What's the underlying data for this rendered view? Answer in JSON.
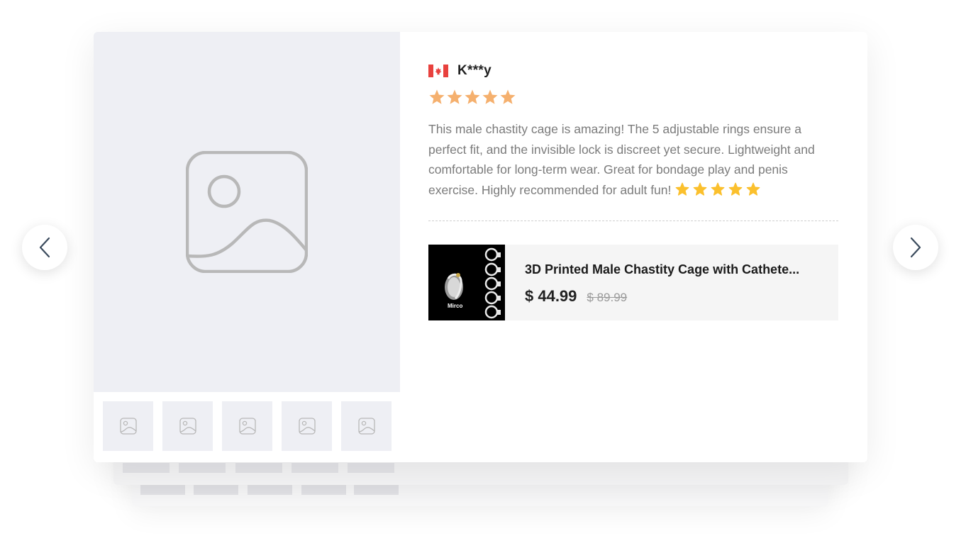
{
  "review": {
    "reviewer_name": "K***y",
    "country": "Canada",
    "rating": 5,
    "text": "This male chastity cage is amazing! The 5 adjustable rings ensure a perfect fit, and the invisible lock is discreet yet secure. Lightweight and comfortable for long-term wear. Great for bondage play and penis exercise. Highly recommended for adult fun!",
    "emoji_star_count": 5
  },
  "product": {
    "title": "3D Printed Male Chastity Cage with Cathete...",
    "price": "$ 44.99",
    "original_price": "$ 89.99",
    "image_label": "Mirco"
  },
  "media": {
    "thumbnail_count": 5
  },
  "colors": {
    "star": "#f5b06e",
    "emoji_star": "#fbc02d",
    "flag_red": "#e8413e",
    "placeholder_bg": "#eeeff4",
    "placeholder_icon": "#b8b8b8"
  },
  "icons": {
    "prev": "chevron-left-icon",
    "next": "chevron-right-icon",
    "image": "image-placeholder-icon"
  }
}
